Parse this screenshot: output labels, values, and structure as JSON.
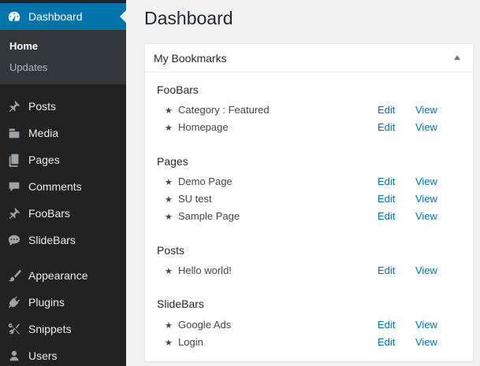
{
  "sidebar": {
    "dashboard_label": "Dashboard",
    "submenu": [
      {
        "label": "Home"
      },
      {
        "label": "Updates"
      }
    ],
    "items": [
      {
        "label": "Posts",
        "icon": "pin-icon"
      },
      {
        "label": "Media",
        "icon": "media-icon"
      },
      {
        "label": "Pages",
        "icon": "pages-icon"
      },
      {
        "label": "Comments",
        "icon": "comment-icon"
      },
      {
        "label": "FooBars",
        "icon": "pin-icon"
      },
      {
        "label": "SlideBars",
        "icon": "chat-icon"
      },
      {
        "label": "Appearance",
        "icon": "brush-icon"
      },
      {
        "label": "Plugins",
        "icon": "plug-icon"
      },
      {
        "label": "Snippets",
        "icon": "scissors-icon"
      },
      {
        "label": "Users",
        "icon": "user-icon"
      }
    ]
  },
  "main": {
    "title": "Dashboard",
    "widget_title": "My Bookmarks",
    "edit_label": "Edit",
    "view_label": "View",
    "groups": [
      {
        "title": "FooBars",
        "items": [
          "Category : Featured",
          "Homepage"
        ]
      },
      {
        "title": "Pages",
        "items": [
          "Demo Page",
          "SU test",
          "Sample Page"
        ]
      },
      {
        "title": "Posts",
        "items": [
          "Hello world!"
        ]
      },
      {
        "title": "SlideBars",
        "items": [
          "Google Ads",
          "Login"
        ]
      }
    ]
  },
  "colors": {
    "sidebar_bg": "#222222",
    "accent": "#0073aa",
    "link": "#0073aa"
  }
}
